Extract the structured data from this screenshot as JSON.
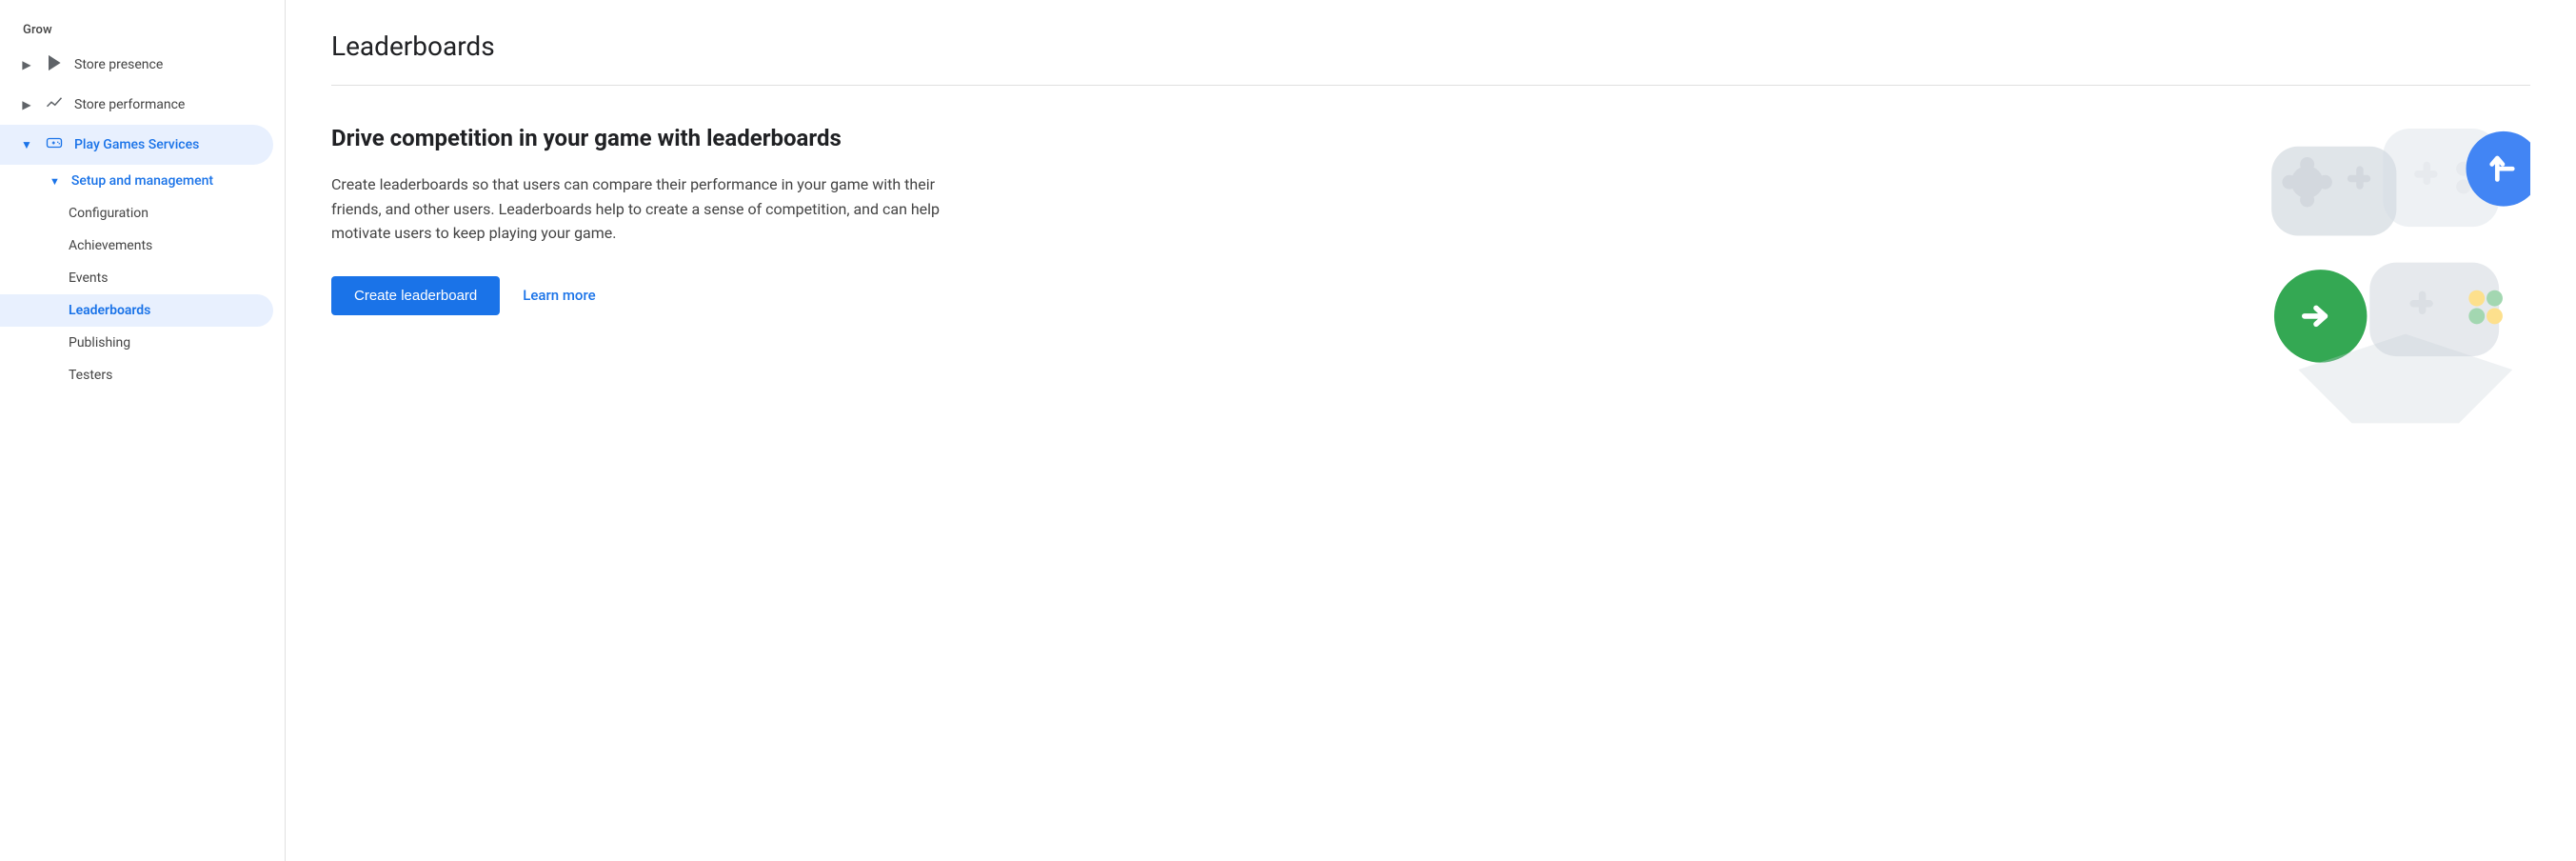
{
  "sidebar": {
    "grow_label": "Grow",
    "items": [
      {
        "id": "store-presence",
        "label": "Store presence",
        "icon": "▷",
        "has_chevron": true,
        "chevron": "▶",
        "active": false
      },
      {
        "id": "store-performance",
        "label": "Store performance",
        "icon": "↗",
        "has_chevron": true,
        "chevron": "▶",
        "active": false
      },
      {
        "id": "play-games-services",
        "label": "Play Games Services",
        "icon": "🎮",
        "has_chevron": true,
        "chevron": "▼",
        "active": true,
        "subitems": [
          {
            "id": "setup-management",
            "label": "Setup and management",
            "chevron": "▼",
            "active": true,
            "subsubitems": [
              {
                "id": "configuration",
                "label": "Configuration",
                "active": false
              },
              {
                "id": "achievements",
                "label": "Achievements",
                "active": false
              },
              {
                "id": "events",
                "label": "Events",
                "active": false
              },
              {
                "id": "leaderboards",
                "label": "Leaderboards",
                "active": true
              },
              {
                "id": "publishing",
                "label": "Publishing",
                "active": false
              },
              {
                "id": "testers",
                "label": "Testers",
                "active": false
              }
            ]
          }
        ]
      }
    ]
  },
  "main": {
    "title": "Leaderboards",
    "promo_heading": "Drive competition in your game with leaderboards",
    "promo_description": "Create leaderboards so that users can compare their performance in your game with their friends, and other users. Leaderboards help to create a sense of competition, and can help motivate users to keep playing your game.",
    "create_button": "Create leaderboard",
    "learn_more": "Learn more"
  }
}
